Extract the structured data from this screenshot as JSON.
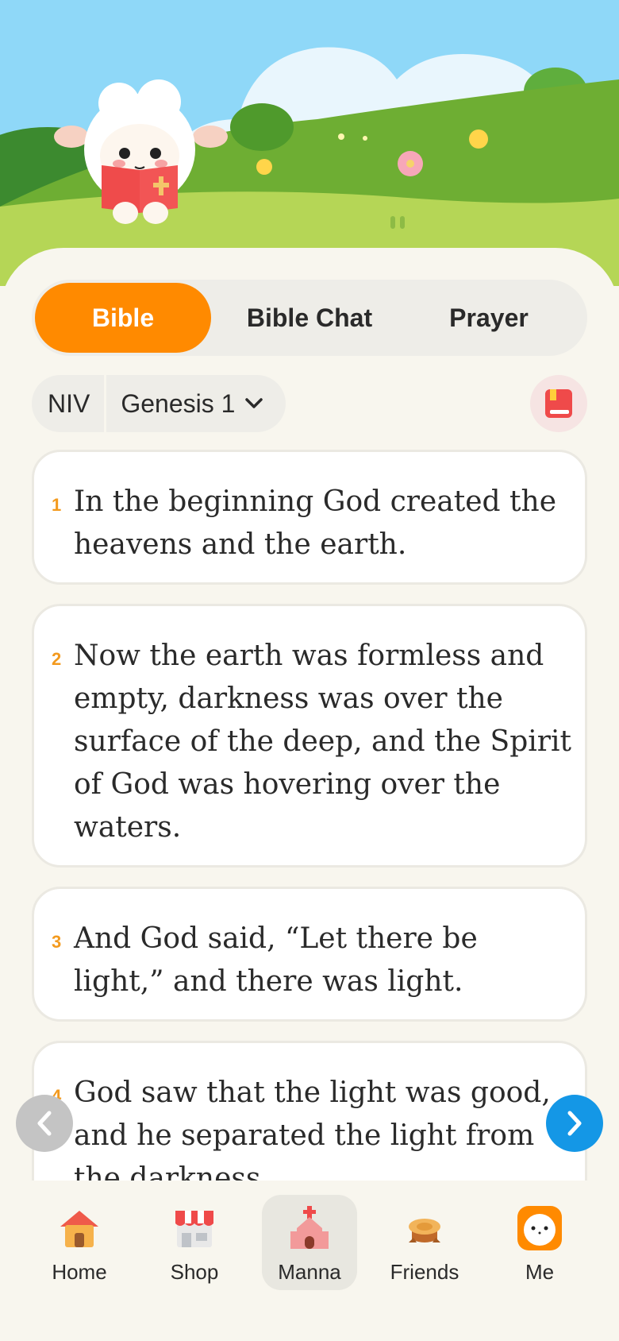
{
  "tabs": [
    {
      "label": "Bible",
      "active": true
    },
    {
      "label": "Bible Chat",
      "active": false
    },
    {
      "label": "Prayer",
      "active": false
    }
  ],
  "version": "NIV",
  "book": "Genesis 1",
  "icons": {
    "dropdown": "chevron-down-icon",
    "bookmark": "bookmark-icon",
    "prev": "chevron-left-icon",
    "next": "chevron-right-icon"
  },
  "verses": [
    {
      "num": "1",
      "text": "In the beginning God created the heavens and the earth."
    },
    {
      "num": "2",
      "text": "Now the earth was formless and empty, darkness was over the surface of the deep, and the Spirit of God was hovering over the waters."
    },
    {
      "num": "3",
      "text": "And God said, “Let there be light,” and there was light."
    },
    {
      "num": "4",
      "text": "God saw that the light was good, and he separated the light from the darkness."
    }
  ],
  "nav": [
    {
      "label": "Home",
      "icon": "house-icon",
      "active": false
    },
    {
      "label": "Shop",
      "icon": "shop-icon",
      "active": false
    },
    {
      "label": "Manna",
      "icon": "church-icon",
      "active": true
    },
    {
      "label": "Friends",
      "icon": "tree-stump-icon",
      "active": false
    },
    {
      "label": "Me",
      "icon": "sheep-avatar-icon",
      "active": false
    }
  ],
  "colors": {
    "accent": "#ff8a00",
    "nextButton": "#1497e6",
    "verseNumber": "#f39a1e",
    "background": "#f8f6ee"
  }
}
